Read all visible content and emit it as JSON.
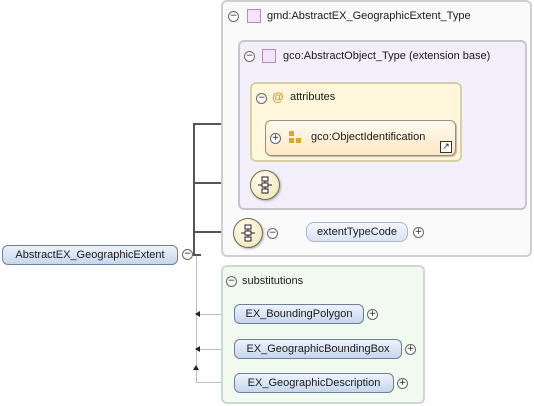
{
  "root": {
    "label": "AbstractEX_GeographicExtent"
  },
  "complex_type": {
    "label": "gmd:AbstractEX_GeographicExtent_Type"
  },
  "extension_base": {
    "label": "gco:AbstractObject_Type (extension base)"
  },
  "attributes": {
    "label": "attributes",
    "group_ref": {
      "label": "gco:ObjectIdentification"
    }
  },
  "sequence": {
    "element": {
      "label": "extentTypeCode"
    }
  },
  "substitutions": {
    "label": "substitutions",
    "items": [
      {
        "label": "EX_BoundingPolygon"
      },
      {
        "label": "EX_GeographicBoundingBox"
      },
      {
        "label": "EX_GeographicDescription"
      }
    ]
  },
  "icons": {
    "collapse": "collapse-minus-icon",
    "expand": "expand-plus-icon",
    "sequence": "sequence-compositor-icon",
    "attribute": "attribute-at-icon",
    "group": "attribute-group-icon",
    "link": "external-link-icon"
  },
  "colors": {
    "element_fill": "#c6d6ee",
    "attribute_fill": "#fff6dc",
    "extension_fill": "#f3effa",
    "substitution_fill": "#f0faef"
  }
}
